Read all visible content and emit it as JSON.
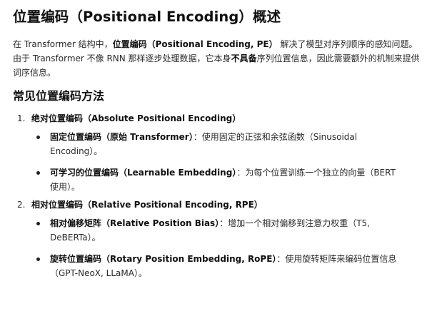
{
  "title": "位置编码（Positional Encoding）概述",
  "intro": {
    "part1": "在 Transformer 结构中，",
    "bold1": "位置编码（Positional Encoding, PE）",
    "part2": " 解决了模型对序列顺序的感知问题。由于 Transformer 不像 RNN 那样逐步处理数据，它本身",
    "bold2": "不具备",
    "part3": "序列位置信息，因此需要额外的机制来提供词序信息。"
  },
  "section_heading": "常见位置编码方法",
  "categories": [
    {
      "number": "1.",
      "title": "绝对位置编码（Absolute Positional Encoding）",
      "items": [
        {
          "title": "固定位置编码（原始 Transformer）",
          "desc": "：使用固定的正弦和余弦函数（Sinusoidal Encoding）。"
        },
        {
          "title": "可学习的位置编码（Learnable Embedding）",
          "desc": "：为每个位置训练一个独立的向量（BERT 使用）。"
        }
      ]
    },
    {
      "number": "2.",
      "title": "相对位置编码（Relative Positional Encoding, RPE）",
      "items": [
        {
          "title": "相对偏移矩阵（Relative Position Bias）",
          "desc": "：增加一个相对偏移到注意力权重（T5, DeBERTa）。"
        },
        {
          "title": "旋转位置编码（Rotary Position Embedding, RoPE）",
          "desc": "：使用旋转矩阵来编码位置信息（GPT-NeoX, LLaMA）。"
        }
      ]
    }
  ]
}
